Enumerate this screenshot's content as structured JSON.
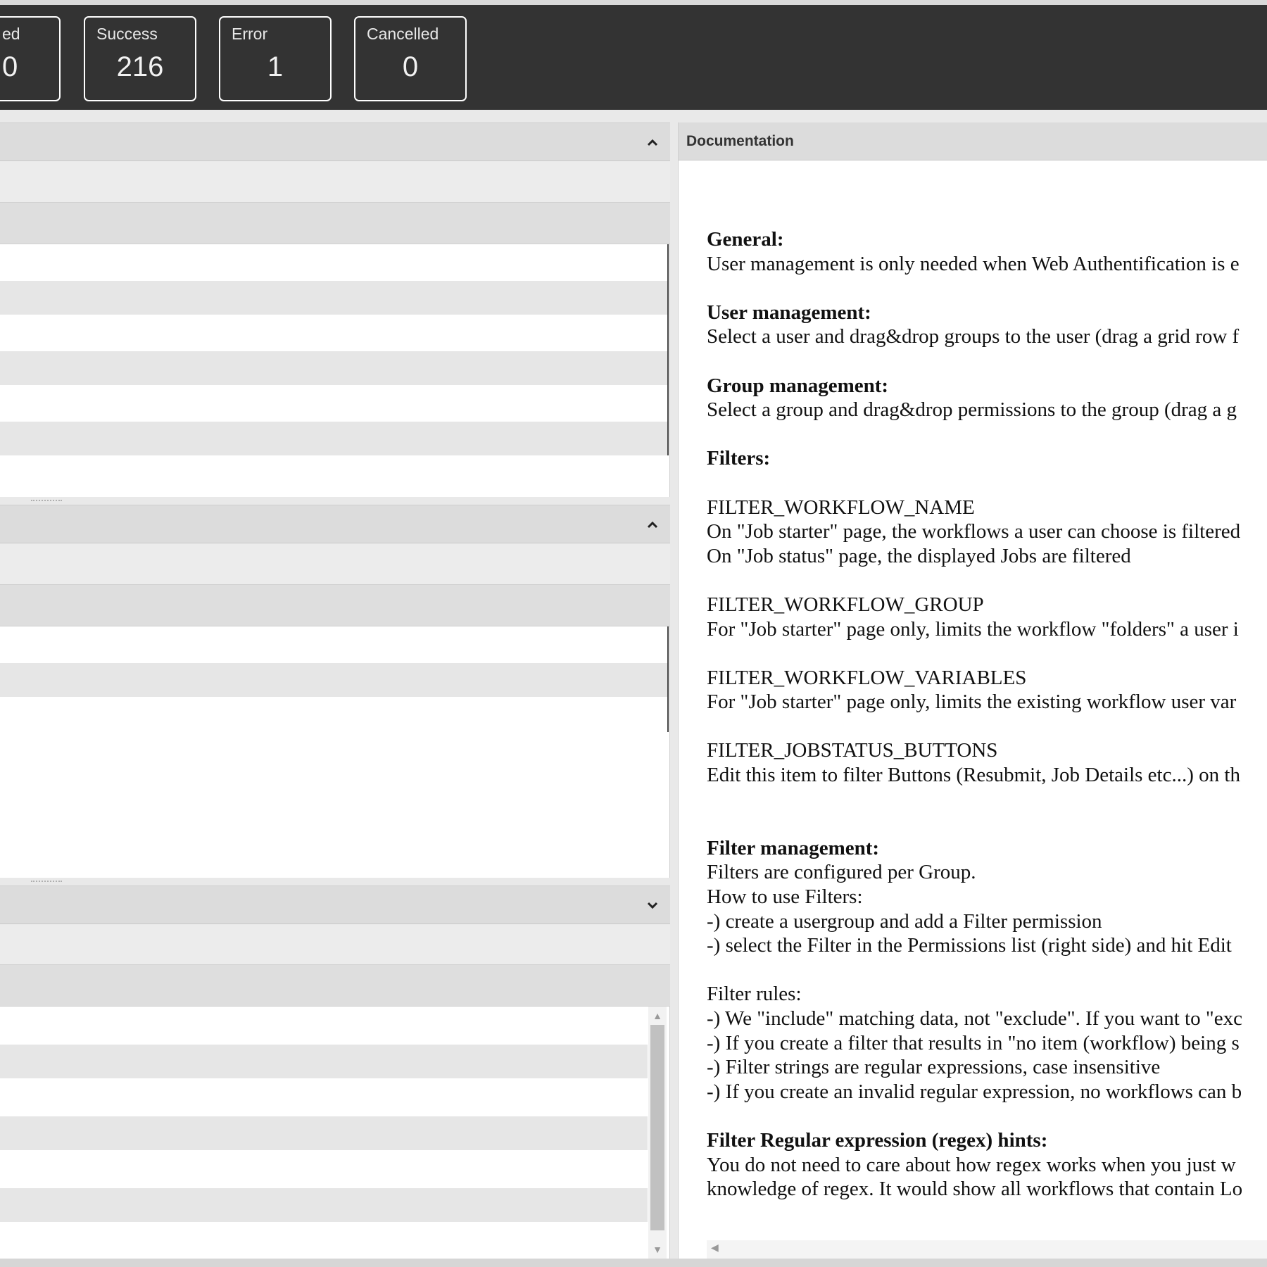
{
  "stats": [
    {
      "label": "ed",
      "value": "0"
    },
    {
      "label": "Success",
      "value": "216"
    },
    {
      "label": "Error",
      "value": "1"
    },
    {
      "label": "Cancelled",
      "value": "0"
    }
  ],
  "documentation": {
    "title": "Documentation",
    "lines": [
      {
        "text": "General:",
        "bold": true
      },
      {
        "text": "User management is only needed when Web Authentification is e",
        "bold": false
      },
      {
        "text": "",
        "bold": false
      },
      {
        "text": "User management:",
        "bold": true
      },
      {
        "text": "Select a user and drag&drop groups to the user (drag a grid row f",
        "bold": false
      },
      {
        "text": "",
        "bold": false
      },
      {
        "text": "Group management:",
        "bold": true
      },
      {
        "text": "Select a group and drag&drop permissions to the group (drag a g",
        "bold": false
      },
      {
        "text": "",
        "bold": false
      },
      {
        "text": "Filters:",
        "bold": true
      },
      {
        "text": "",
        "bold": false
      },
      {
        "text": "FILTER_WORKFLOW_NAME",
        "bold": false
      },
      {
        "text": "On \"Job starter\" page, the workflows a user can choose is filtered",
        "bold": false
      },
      {
        "text": "On \"Job status\" page, the displayed Jobs are filtered",
        "bold": false
      },
      {
        "text": "",
        "bold": false
      },
      {
        "text": "FILTER_WORKFLOW_GROUP",
        "bold": false
      },
      {
        "text": "For \"Job starter\" page only, limits the workflow \"folders\" a user i",
        "bold": false
      },
      {
        "text": "",
        "bold": false
      },
      {
        "text": "FILTER_WORKFLOW_VARIABLES",
        "bold": false
      },
      {
        "text": "For \"Job starter\" page only, limits the existing workflow user var",
        "bold": false
      },
      {
        "text": "",
        "bold": false
      },
      {
        "text": "FILTER_JOBSTATUS_BUTTONS",
        "bold": false
      },
      {
        "text": "Edit this item to filter Buttons (Resubmit, Job Details etc...) on th",
        "bold": false
      },
      {
        "text": "",
        "bold": false
      },
      {
        "text": "",
        "bold": false
      },
      {
        "text": "Filter management:",
        "bold": true
      },
      {
        "text": "Filters are configured per Group.",
        "bold": false
      },
      {
        "text": "How to use Filters:",
        "bold": false
      },
      {
        "text": "-) create a usergroup and add a Filter permission",
        "bold": false
      },
      {
        "text": "-) select the Filter in the Permissions list (right side) and hit Edit",
        "bold": false
      },
      {
        "text": "",
        "bold": false
      },
      {
        "text": "Filter rules:",
        "bold": false
      },
      {
        "text": "-) We \"include\" matching data, not \"exclude\". If you want to \"exc",
        "bold": false
      },
      {
        "text": "-) If you create a filter that results in \"no item (workflow) being s",
        "bold": false
      },
      {
        "text": "-) Filter strings are regular expressions, case insensitive",
        "bold": false
      },
      {
        "text": "-) If you create an invalid regular expression, no workflows can b",
        "bold": false
      },
      {
        "text": "",
        "bold": false
      },
      {
        "text": "Filter Regular expression (regex) hints:",
        "bold": true
      },
      {
        "text": "You do not need to care about how regex works when you just w",
        "bold": false
      },
      {
        "text": "knowledge of regex. It would show all workflows that contain Lo",
        "bold": false
      }
    ]
  }
}
